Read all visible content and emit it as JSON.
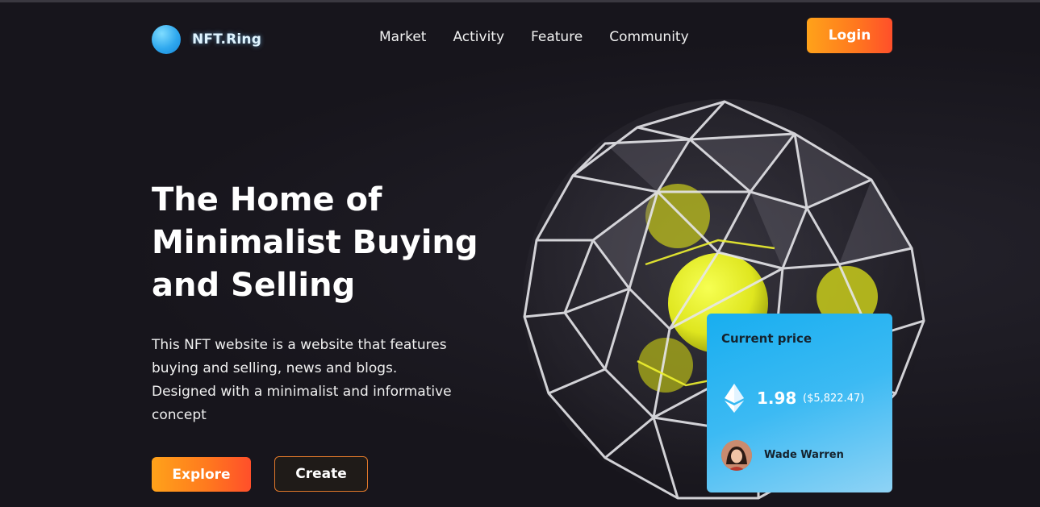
{
  "header": {
    "logo_text": "NFT.Ring",
    "nav": [
      "Market",
      "Activity",
      "Feature",
      "Community"
    ],
    "login_label": "Login"
  },
  "hero": {
    "title_lines": [
      "The Home of",
      "Minimalist Buying",
      "and Selling"
    ],
    "description_lines": [
      "This NFT website is a website that features",
      "buying and selling, news and blogs.",
      "Designed with a minimalist and informative",
      "concept"
    ],
    "explore_label": "Explore",
    "create_label": "Create"
  },
  "price_card": {
    "label": "Current price",
    "price": "1.98",
    "price_usd": "($5,822.47)",
    "owner_name": "Wade Warren",
    "currency_icon": "ethereum-icon"
  },
  "colors": {
    "background": "#17151c",
    "accent_orange": "#ff7a1e",
    "accent_blue": "#18aef0",
    "highlight_yellow": "#eaf12a"
  }
}
